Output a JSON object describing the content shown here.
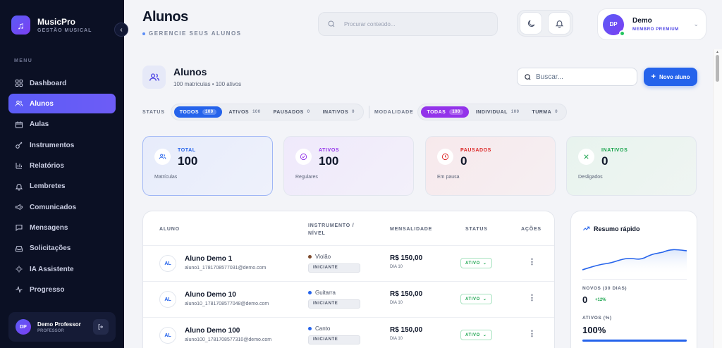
{
  "brand": {
    "name": "MusicPro",
    "subtitle": "GESTÃO MUSICAL"
  },
  "sidebar": {
    "menu_label": "MENU",
    "items": [
      {
        "label": "Dashboard",
        "icon": "grid-icon"
      },
      {
        "label": "Alunos",
        "icon": "users-icon",
        "active": true
      },
      {
        "label": "Aulas",
        "icon": "calendar-icon"
      },
      {
        "label": "Instrumentos",
        "icon": "guitar-icon"
      },
      {
        "label": "Relatórios",
        "icon": "bar-chart-icon"
      },
      {
        "label": "Lembretes",
        "icon": "bell-icon"
      },
      {
        "label": "Comunicados",
        "icon": "megaphone-icon"
      },
      {
        "label": "Mensagens",
        "icon": "message-icon"
      },
      {
        "label": "Solicitações",
        "icon": "inbox-icon"
      },
      {
        "label": "IA Assistente",
        "icon": "sparkle-icon"
      },
      {
        "label": "Progresso",
        "icon": "activity-icon"
      }
    ],
    "user": {
      "initials": "DP",
      "name": "Demo Professor",
      "role": "PROFESSOR"
    }
  },
  "header": {
    "title": "Alunos",
    "subtitle": "GERENCIE SEUS ALUNOS",
    "search_placeholder": "Procurar conteúdo...",
    "profile": {
      "initials": "DP",
      "name": "Demo",
      "plan": "MEMBRO PREMIUM"
    }
  },
  "content": {
    "title": "Alunos",
    "subtitle": "100 matrículas • 100 ativos",
    "search_placeholder": "Buscar...",
    "new_button": "Novo aluno"
  },
  "filters": {
    "status_label": "STATUS",
    "status_options": [
      {
        "label": "TODOS",
        "count": "100",
        "active": true
      },
      {
        "label": "ATIVOS",
        "count": "100"
      },
      {
        "label": "PAUSADOS",
        "count": "0"
      },
      {
        "label": "INATIVOS",
        "count": "0"
      }
    ],
    "mode_label": "MODALIDADE",
    "mode_options": [
      {
        "label": "TODAS",
        "count": "100",
        "active": true
      },
      {
        "label": "INDIVIDUAL",
        "count": "100"
      },
      {
        "label": "TURMA",
        "count": "0"
      }
    ]
  },
  "stats": [
    {
      "label": "TOTAL",
      "value": "100",
      "desc": "Matrículas",
      "color": "#2563eb",
      "icon": "users-icon"
    },
    {
      "label": "ATIVOS",
      "value": "100",
      "desc": "Regulares",
      "color": "#9333ea",
      "icon": "check-circle-icon"
    },
    {
      "label": "PAUSADOS",
      "value": "0",
      "desc": "Em pausa",
      "color": "#dc2626",
      "icon": "clock-icon"
    },
    {
      "label": "INATIVOS",
      "value": "0",
      "desc": "Desligados",
      "color": "#16a34a",
      "icon": "x-icon"
    }
  ],
  "table": {
    "headers": {
      "student": "ALUNO",
      "instrument": "INSTRUMENTO /",
      "level": "NÍVEL",
      "fee": "MENSALIDADE",
      "status": "STATUS",
      "actions": "AÇÕES"
    },
    "rows": [
      {
        "initials": "AL",
        "name": "Aluno Demo 1",
        "email": "aluno1_1781708577031@demo.com",
        "instrument": "Violão",
        "inst_color": "#7c4a2d",
        "level": "INICIANTE",
        "fee": "R$ 150,00",
        "due": "DIA 10",
        "status": "ATIVO"
      },
      {
        "initials": "AL",
        "name": "Aluno Demo 10",
        "email": "aluno10_1781708577048@demo.com",
        "instrument": "Guitarra",
        "inst_color": "#2563eb",
        "level": "INICIANTE",
        "fee": "R$ 150,00",
        "due": "DIA 10",
        "status": "ATIVO"
      },
      {
        "initials": "AL",
        "name": "Aluno Demo 100",
        "email": "aluno100_1781708577310@demo.com",
        "instrument": "Canto",
        "inst_color": "#2563eb",
        "level": "INICIANTE",
        "fee": "R$ 150,00",
        "due": "DIA 10",
        "status": "ATIVO"
      }
    ]
  },
  "summary": {
    "title": "Resumo rápido",
    "new_label": "NOVOS (30 DIAS)",
    "new_value": "0",
    "new_delta": "+12%",
    "active_label": "ATIVOS (%)",
    "active_value": "100%",
    "active_fraction": 1.0
  },
  "colors": {
    "accent": "#2563eb",
    "sidebar_bg": "#0b1024",
    "active_nav": "#5b5cf6"
  }
}
